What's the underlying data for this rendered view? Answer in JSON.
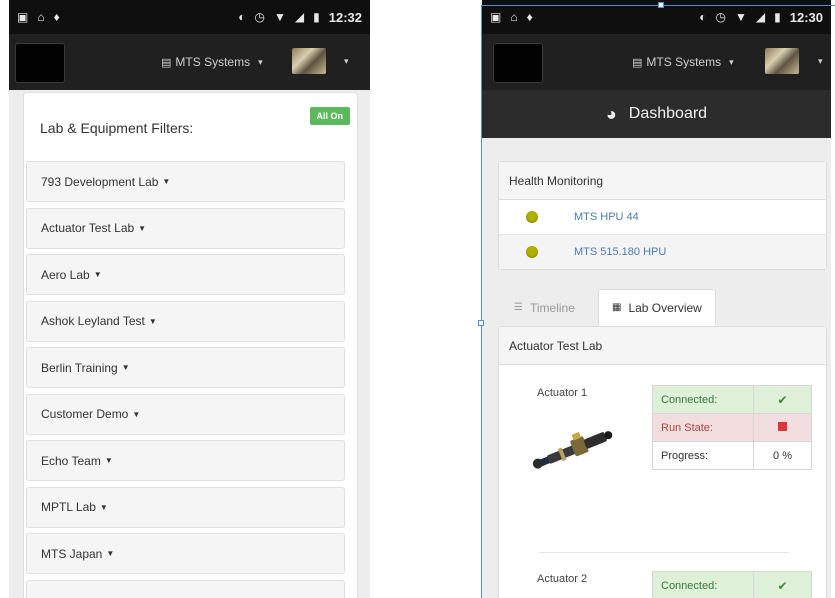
{
  "left_phone": {
    "status": {
      "time": "12:32"
    },
    "nav": {
      "org_label": "MTS Systems",
      "org_caret": "▾",
      "user_caret": "▾"
    },
    "filters": {
      "title": "Lab & Equipment Filters:",
      "all_on_label": "All On",
      "labs": [
        "793 Development Lab",
        "Actuator Test Lab",
        "Aero Lab",
        "Ashok Leyland Test",
        "Berlin Training",
        "Customer Demo",
        "Echo Team",
        "MPTL Lab",
        "MTS Japan",
        ""
      ]
    }
  },
  "right_phone": {
    "status": {
      "time": "12:30"
    },
    "nav": {
      "org_label": "MTS Systems",
      "org_caret": "▾",
      "user_caret": "▾"
    },
    "dashboard": {
      "title": "Dashboard"
    },
    "health": {
      "title": "Health Monitoring",
      "items": [
        {
          "name": "MTS HPU 44",
          "status_color": "#b0b000"
        },
        {
          "name": "MTS 515.180 HPU",
          "status_color": "#b0b000"
        }
      ]
    },
    "tabs": [
      {
        "label": "Timeline",
        "icon": "list-icon",
        "active": false
      },
      {
        "label": "Lab Overview",
        "icon": "table-icon",
        "active": true
      }
    ],
    "lab_overview": {
      "lab_name": "Actuator Test Lab",
      "actuators": [
        {
          "name": "Actuator 1",
          "rows": [
            {
              "label": "Connected:",
              "value": "✔",
              "state": "success"
            },
            {
              "label": "Run State:",
              "value": "",
              "state": "danger"
            },
            {
              "label": "Progress:",
              "value": "0 %",
              "state": "plain"
            }
          ]
        },
        {
          "name": "Actuator 2",
          "rows": [
            {
              "label": "Connected:",
              "value": "✔",
              "state": "success"
            }
          ]
        }
      ]
    }
  }
}
